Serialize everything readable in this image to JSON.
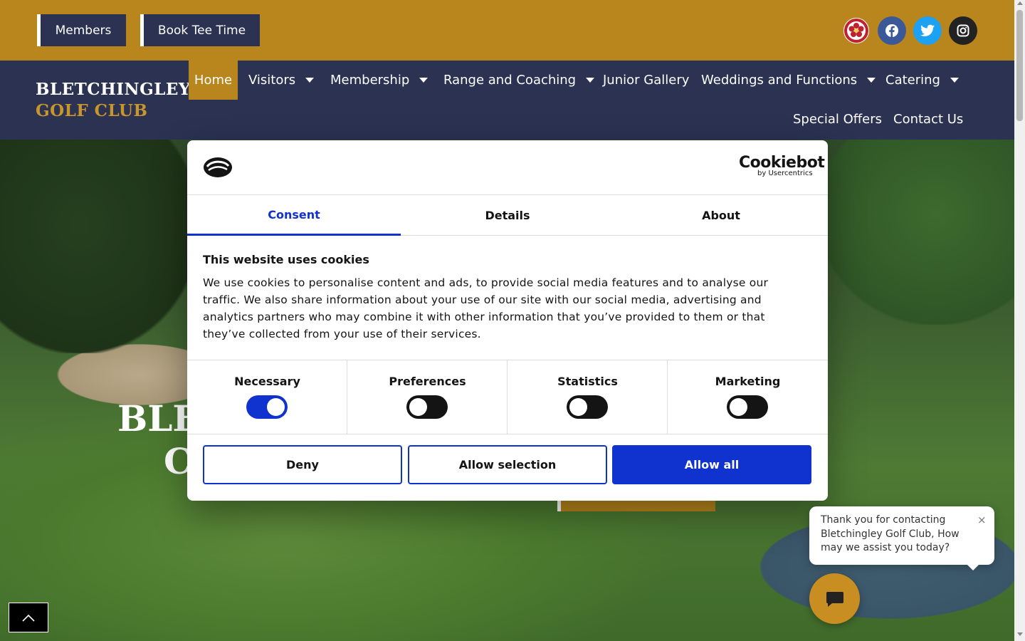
{
  "topbar": {
    "members_label": "Members",
    "book_label": "Book Tee Time",
    "social": [
      "rose-badge-icon",
      "facebook-icon",
      "twitter-icon",
      "instagram-icon"
    ]
  },
  "logo": {
    "line1": "BLETCHINGLEY",
    "line2": "GOLF CLUB"
  },
  "nav": {
    "items": [
      {
        "label": "Home",
        "dropdown": false,
        "active": true
      },
      {
        "label": "Visitors",
        "dropdown": true
      },
      {
        "label": "Membership",
        "dropdown": true
      },
      {
        "label": "Range and Coaching",
        "dropdown": true
      },
      {
        "label": "Junior Gallery",
        "dropdown": false
      },
      {
        "label": "Weddings and Functions",
        "dropdown": true
      },
      {
        "label": "Catering",
        "dropdown": true
      },
      {
        "label": "Special Offers",
        "dropdown": false
      },
      {
        "label": "Contact Us",
        "dropdown": false
      }
    ]
  },
  "hero": {
    "title_line1_visible": "BLE",
    "title_line2_visible": "C"
  },
  "cookie": {
    "brand": "Cookiebot",
    "brand_sub": "by Usercentrics",
    "tabs": [
      "Consent",
      "Details",
      "About"
    ],
    "title": "This website uses cookies",
    "body": "We use cookies to personalise content and ads, to provide social media features and to analyse our traffic. We also share information about your use of our site with our social media, advertising and analytics partners who may combine it with other information that you’ve provided to them or that they’ve collected from your use of their services.",
    "toggles": [
      {
        "label": "Necessary",
        "on": true
      },
      {
        "label": "Preferences",
        "on": false
      },
      {
        "label": "Statistics",
        "on": false
      },
      {
        "label": "Marketing",
        "on": false
      }
    ],
    "buttons": {
      "deny": "Deny",
      "allow_selection": "Allow selection",
      "allow_all": "Allow all"
    },
    "accent": "#1032cf"
  },
  "chat": {
    "message": "Thank you for contacting Bletchingley Golf Club, How may we assist you today?",
    "close": "×"
  },
  "colors": {
    "gold": "#b8861c",
    "navy": "#2b3252"
  }
}
